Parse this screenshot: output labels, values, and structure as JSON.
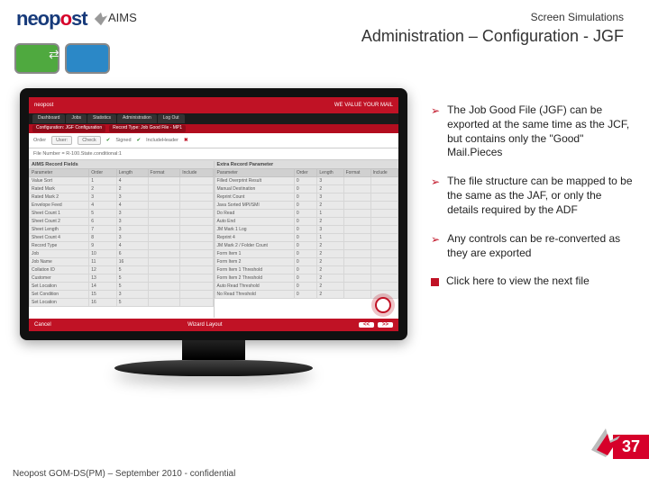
{
  "brand": {
    "name_html_parts": [
      "neop",
      "o",
      "st"
    ],
    "aims": "AIMS"
  },
  "header": {
    "eyebrow": "Screen Simulations",
    "title": "Administration – Configuration  - JGF"
  },
  "app": {
    "logo": "neopost",
    "tagline": "WE VALUE YOUR MAIL",
    "tabs": [
      "Dashboard",
      "Jobs",
      "Statistics",
      "Administration",
      "Log Out"
    ],
    "crumbs": [
      "Configuration: JGF Configuration",
      "Record Type: Job Good File - MP1"
    ],
    "filter": {
      "order": "Order",
      "user": "User:",
      "check": "Check",
      "signed_label": "Signed",
      "include_label": "IncludeHeader",
      "fileno_label": "File Number = R-100.State.conditional:1"
    },
    "left": {
      "heading": "AIMS Record Fields",
      "cols": [
        "Parameter",
        "Order",
        "Length",
        "Format",
        "Include"
      ],
      "rows": [
        [
          "Value Sort",
          "1",
          "4",
          "",
          ""
        ],
        [
          "Rated Mark",
          "2",
          "2",
          "",
          ""
        ],
        [
          "Rated Mark 2",
          "3",
          "3",
          "",
          ""
        ],
        [
          "Envelope Feed",
          "4",
          "4",
          "",
          ""
        ],
        [
          "Sheet Count 1",
          "5",
          "3",
          "",
          ""
        ],
        [
          "Sheet Count 2",
          "6",
          "3",
          "",
          ""
        ],
        [
          "Sheet Length",
          "7",
          "3",
          "",
          ""
        ],
        [
          "Sheet Count 4",
          "8",
          "3",
          "",
          ""
        ],
        [
          "Record Type",
          "9",
          "4",
          "",
          ""
        ],
        [
          "Job",
          "10",
          "6",
          "",
          ""
        ],
        [
          "Job Name",
          "11",
          "16",
          "",
          ""
        ],
        [
          "Collation ID",
          "12",
          "5",
          "",
          ""
        ],
        [
          "Customer",
          "13",
          "5",
          "",
          ""
        ],
        [
          "Set Location",
          "14",
          "5",
          "",
          ""
        ],
        [
          "Set Condition",
          "15",
          "3",
          "",
          ""
        ],
        [
          "Set Location",
          "16",
          "5",
          "",
          ""
        ]
      ]
    },
    "right": {
      "heading": "Extra Record Parameter",
      "cols": [
        "Parameter",
        "Order",
        "Length",
        "Format",
        "Include"
      ],
      "rows": [
        [
          "Filled Overprint Result",
          "0",
          "3",
          "",
          ""
        ],
        [
          "Manual Destination",
          "0",
          "2",
          "",
          ""
        ],
        [
          "Reprint Count",
          "0",
          "3",
          "",
          ""
        ],
        [
          "Java Sorted MPI/SMI",
          "0",
          "2",
          "",
          ""
        ],
        [
          "Do Read",
          "0",
          "1",
          "",
          ""
        ],
        [
          "Auto End",
          "0",
          "2",
          "",
          ""
        ],
        [
          "JM Mark 1 Log",
          "0",
          "3",
          "",
          ""
        ],
        [
          "Reprint 4",
          "0",
          "1",
          "",
          ""
        ],
        [
          "JM Mark 2 / Folder Count",
          "0",
          "2",
          "",
          ""
        ],
        [
          "Form Item 1",
          "0",
          "2",
          "",
          ""
        ],
        [
          "Form Item 2",
          "0",
          "2",
          "",
          ""
        ],
        [
          "Form Item 1 Threshold",
          "0",
          "2",
          "",
          ""
        ],
        [
          "Form Item 2 Threshold",
          "0",
          "2",
          "",
          ""
        ],
        [
          "Auto Read Threshold",
          "0",
          "2",
          "",
          ""
        ],
        [
          "No Read Threshold",
          "0",
          "2",
          "",
          ""
        ]
      ]
    },
    "footer": {
      "left": "Cancel",
      "center": "Wizard Layout",
      "prev": "<<",
      "next": ">>"
    }
  },
  "bullets": [
    {
      "icon": "arrow",
      "text": "The Job Good File (JGF) can be exported at the same time as the JCF, but contains only the \"Good\" Mail.Pieces"
    },
    {
      "icon": "arrow",
      "text": "The file structure can be mapped to be the same as the JAF, or only the details required by the ADF"
    },
    {
      "icon": "arrow",
      "text": "Any controls can be re-converted as they are exported"
    },
    {
      "icon": "square",
      "text": "Click here to view the next file"
    }
  ],
  "page_number": "37",
  "footer_note": "Neopost GOM-DS(PM) – September 2010 - confidential"
}
